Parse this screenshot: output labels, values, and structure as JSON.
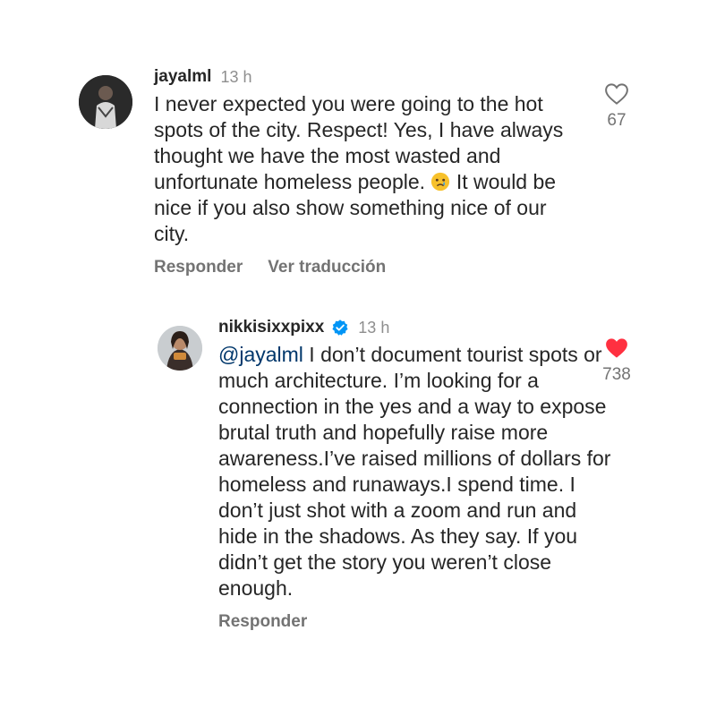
{
  "comments": [
    {
      "username": "jayalml",
      "time": "13 h",
      "text_before_emoji": "I never expected you were going to the hot spots of the city. Respect! Yes, I have always thought we have the most wasted and unfortunate homeless people.",
      "emoji": "😢",
      "text_after_emoji": "It would be nice if you also show something nice of our city.",
      "reply_label": "Responder",
      "translate_label": "Ver traducción",
      "like_count": "67",
      "liked": false,
      "like_color": "#737373"
    },
    {
      "username": "nikkisixxpixx",
      "verified": true,
      "time": "13 h",
      "mention": "@jayalml",
      "text": " I don’t document tourist spots or much architecture. I’m looking for a connection in the yes and a way to expose brutal truth and hopefully raise more awareness.I’ve raised millions of dollars for homeless and runaways.I spend time. I don’t just shot with a zoom and run and hide in the shadows. As they say. If you didn’t get the story you weren’t close enough.",
      "reply_label": "Responder",
      "like_count": "738",
      "liked": true,
      "like_color": "#ff3040",
      "verified_color": "#0095f6"
    }
  ]
}
